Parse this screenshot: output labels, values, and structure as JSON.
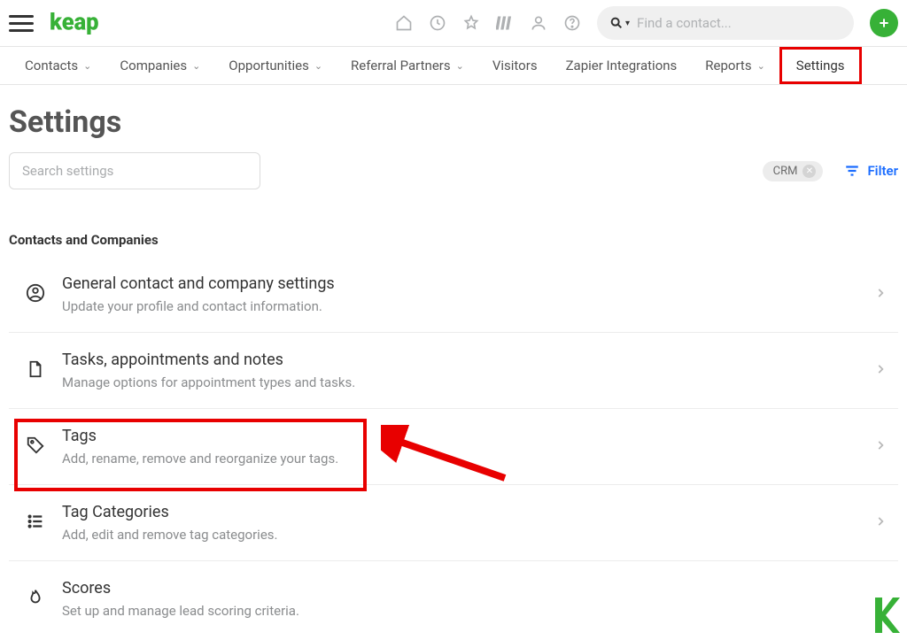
{
  "brand": "keap",
  "search_placeholder": "Find a contact...",
  "nav": [
    {
      "label": "Contacts",
      "dropdown": true
    },
    {
      "label": "Companies",
      "dropdown": true
    },
    {
      "label": "Opportunities",
      "dropdown": true
    },
    {
      "label": "Referral Partners",
      "dropdown": true
    },
    {
      "label": "Visitors",
      "dropdown": false
    },
    {
      "label": "Zapier Integrations",
      "dropdown": false
    },
    {
      "label": "Reports",
      "dropdown": true
    },
    {
      "label": "Settings",
      "dropdown": false
    }
  ],
  "page_title": "Settings",
  "settings_search_placeholder": "Search settings",
  "pill": {
    "label": "CRM"
  },
  "filter_label": "Filter",
  "section_title": "Contacts and Companies",
  "rows": [
    {
      "title": "General contact and company settings",
      "desc": "Update your profile and contact information."
    },
    {
      "title": "Tasks, appointments and notes",
      "desc": "Manage options for appointment types and tasks."
    },
    {
      "title": "Tags",
      "desc": "Add, rename, remove and reorganize your tags."
    },
    {
      "title": "Tag Categories",
      "desc": "Add, edit and remove tag categories."
    },
    {
      "title": "Scores",
      "desc": "Set up and manage lead scoring criteria."
    }
  ]
}
